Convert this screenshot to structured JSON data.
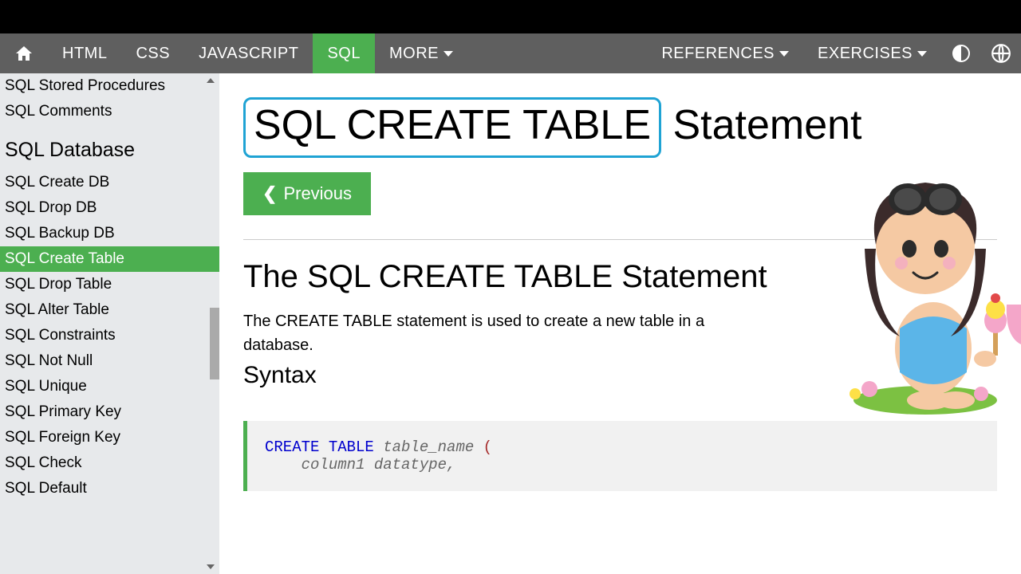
{
  "topnav": {
    "items": [
      "HTML",
      "CSS",
      "JAVASCRIPT",
      "SQL",
      "MORE"
    ],
    "active_index": 3,
    "right_items": [
      "REFERENCES",
      "EXERCISES"
    ]
  },
  "sidebar": {
    "top_items": [
      "SQL Stored Procedures",
      "SQL Comments"
    ],
    "heading": "SQL Database",
    "items": [
      "SQL Create DB",
      "SQL Drop DB",
      "SQL Backup DB",
      "SQL Create Table",
      "SQL Drop Table",
      "SQL Alter Table",
      "SQL Constraints",
      "SQL Not Null",
      "SQL Unique",
      "SQL Primary Key",
      "SQL Foreign Key",
      "SQL Check",
      "SQL Default"
    ],
    "active_index": 3
  },
  "page": {
    "title_boxed": "SQL CREATE TABLE",
    "title_rest": " Statement",
    "prev_label": "Previous",
    "section_heading": "The SQL CREATE TABLE Statement",
    "section_text": "The CREATE TABLE statement is used to create a new table in a database.",
    "syntax_label": "Syntax"
  },
  "code": {
    "kw": "CREATE TABLE",
    "name": " table_name ",
    "open": "(",
    "line2": "    column1 datatype,"
  }
}
